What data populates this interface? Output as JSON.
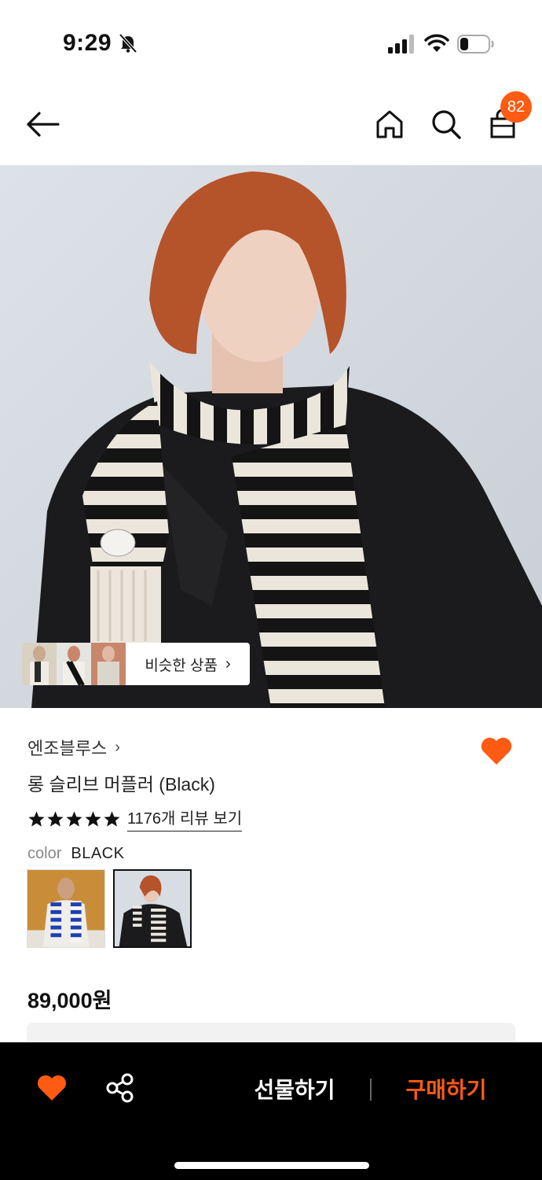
{
  "status_bar": {
    "time": "9:29",
    "icons": [
      "bell-slash-icon",
      "cellular-signal-icon",
      "wifi-icon",
      "battery-icon"
    ]
  },
  "header": {
    "icons": [
      "back-arrow-icon",
      "home-icon",
      "search-icon",
      "shopping-bag-icon"
    ],
    "cart_count": "82",
    "badge_color": "#ff5b12"
  },
  "hero": {
    "similar_label": "비슷한 상품"
  },
  "product": {
    "brand": "엔조블루스",
    "name": "롱 슬리브 머플러 (Black)",
    "rating_stars": 5,
    "review_link": "1176개 리뷰 보기",
    "color_key": "color",
    "color_value": "BLACK",
    "color_options": [
      "blue-stripe",
      "black-stripe"
    ],
    "selected_color_index": 1,
    "price": "89,000원"
  },
  "bottom_bar": {
    "gift_label": "선물하기",
    "buy_label": "구매하기",
    "accent_color": "#ff5b12",
    "icons": [
      "heart-icon",
      "share-icon"
    ]
  }
}
